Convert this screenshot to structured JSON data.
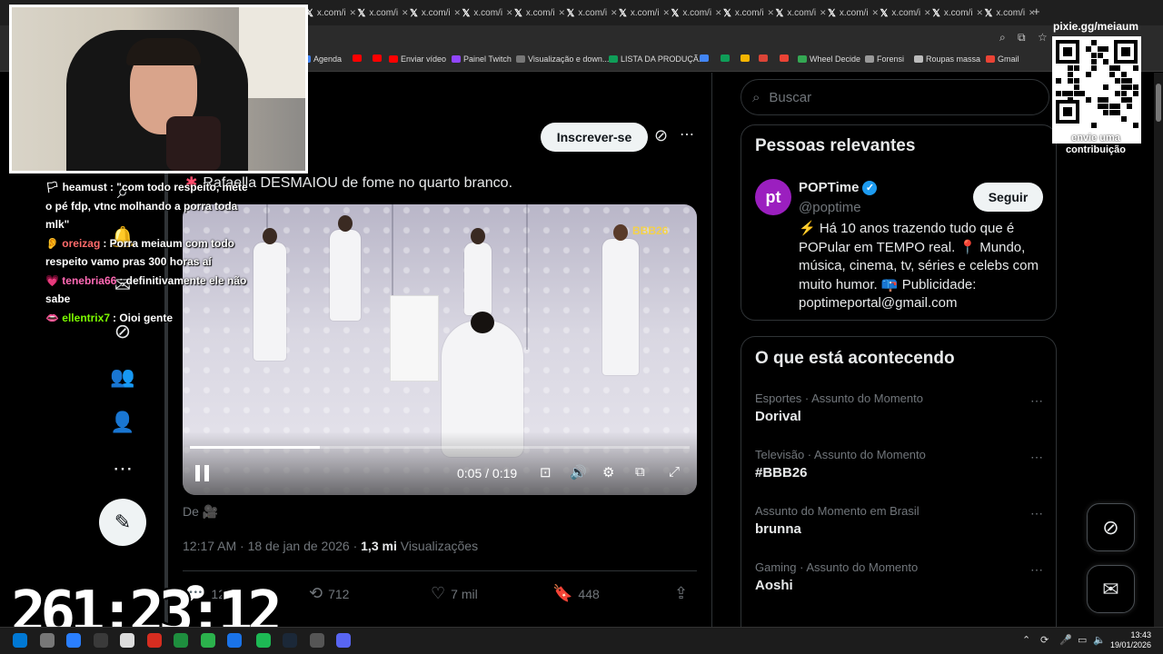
{
  "browser": {
    "tab_label": "x.com/i",
    "tab_close": "✕",
    "new_tab": "+",
    "bookmarks": [
      {
        "label": "Agenda",
        "color": "#4285f4"
      },
      {
        "label": "",
        "color": "#ff0000"
      },
      {
        "label": "",
        "color": "#ff0000"
      },
      {
        "label": "Enviar vídeo",
        "color": "#ff0000"
      },
      {
        "label": "Painel Twitch",
        "color": "#9146ff"
      },
      {
        "label": "Visualização e down...",
        "color": "#777777"
      },
      {
        "label": "LISTA DA PRODUÇÃ...",
        "color": "#0f9d58"
      },
      {
        "label": "",
        "color": "#4285f4"
      },
      {
        "label": "",
        "color": "#0f9d58"
      },
      {
        "label": "",
        "color": "#f4b400"
      },
      {
        "label": "",
        "color": "#db4437"
      },
      {
        "label": "",
        "color": "#ea4335"
      },
      {
        "label": "Wheel Decide",
        "color": "#34a853"
      },
      {
        "label": "Forensi",
        "color": "#999999"
      },
      {
        "label": "Roupas massa",
        "color": "#bbbbbb"
      },
      {
        "label": "Gmail",
        "color": "#ea4335"
      }
    ]
  },
  "post": {
    "subscribe_label": "Inscrever-se",
    "text": "Rafaella DESMAIOU de fome no quarto branco.",
    "from_label": "De 🎥",
    "time": "12:17 AM · 18 de jan de 2026 · ",
    "views_count": "1,3 mi",
    "views_label": " Visualizações",
    "video": {
      "current_time": "0:05",
      "duration": "0:19",
      "time_display": "0:05 / 0:19",
      "progress": 0.26,
      "channel_logo": "BBB26"
    },
    "actions": {
      "replies": "12",
      "reposts": "712",
      "likes": "7 mil",
      "bookmarks": "448"
    }
  },
  "sidebar": {
    "search_placeholder": "Buscar",
    "relevant_title": "Pessoas relevantes",
    "account": {
      "avatar_text": "pt",
      "name": "POPTime",
      "handle": "@poptime",
      "follow_label": "Seguir",
      "bio": "⚡ Há 10 anos trazendo tudo que é POPular em TEMPO real. 📍 Mundo, música, cinema, tv, séries e celebs com muito humor. 📪 Publicidade: poptimeportal@gmail.com"
    },
    "trends_title": "O que está acontecendo",
    "trends": [
      {
        "category": "Esportes · Assunto do Momento",
        "name": "Dorival"
      },
      {
        "category": "Televisão · Assunto do Momento",
        "name": "#BBB26"
      },
      {
        "category": "Assunto do Momento em Brasil",
        "name": "brunna"
      },
      {
        "category": "Gaming · Assunto do Momento",
        "name": "Aoshi"
      }
    ]
  },
  "stream": {
    "chat": [
      {
        "user": "heamust",
        "user_color": "#ffffff",
        "badge": "🏳",
        "message": ": \"com todo respeito, mete o pé fdp, vtnc molhando a porra toda mlk\""
      },
      {
        "user": "oreizag",
        "user_color": "#ff6b6b",
        "badge": "👂",
        "message": ": Porra meiaum com todo respeito vamo pras 300 horas aí"
      },
      {
        "user": "tenebria66",
        "user_color": "#ff69b4",
        "badge": "💗",
        "message": ": definitivamente ele não sabe"
      },
      {
        "user": "ellentrix7",
        "user_color": "#7cfc00",
        "badge": "👄",
        "message": ": Oioi gente"
      }
    ],
    "timer": "261:23:12",
    "qr_title": "pixie.gg/meiaum",
    "qr_caption": "envie uma contribuição"
  },
  "taskbar": {
    "time": "13:43",
    "date": "19/01/2026"
  }
}
